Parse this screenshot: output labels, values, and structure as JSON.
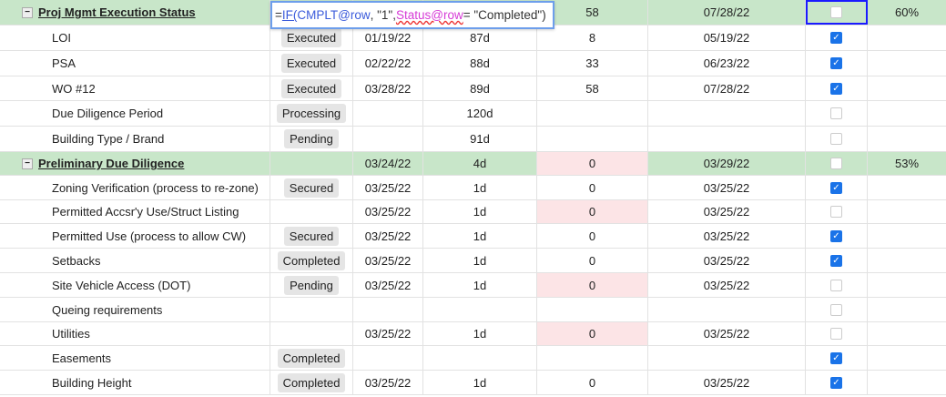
{
  "formula": {
    "eq": "=",
    "fn": "IF(",
    "ref1": "CMPLT@row",
    "mid": ", \"1\", ",
    "ref2": "Status@row",
    "tail": " = \"Completed\")"
  },
  "rows": [
    {
      "group": true,
      "name": "Proj Mgmt Execution Status",
      "status": "",
      "start": "",
      "dur": "",
      "num": "58",
      "end": "07/28/22",
      "checked": false,
      "pct": "60%",
      "pink": false,
      "selected": true
    },
    {
      "name": "LOI",
      "status": "Executed",
      "start": "01/19/22",
      "dur": "87d",
      "num": "8",
      "end": "05/19/22",
      "checked": true,
      "pct": ""
    },
    {
      "name": "PSA",
      "status": "Executed",
      "start": "02/22/22",
      "dur": "88d",
      "num": "33",
      "end": "06/23/22",
      "checked": true,
      "pct": ""
    },
    {
      "name": "WO #12",
      "status": "Executed",
      "start": "03/28/22",
      "dur": "89d",
      "num": "58",
      "end": "07/28/22",
      "checked": true,
      "pct": ""
    },
    {
      "name": "Due Diligence Period",
      "status": "Processing",
      "start": "",
      "dur": "120d",
      "num": "",
      "end": "",
      "checked": false,
      "pct": ""
    },
    {
      "name": "Building Type / Brand",
      "status": "Pending",
      "start": "",
      "dur": "91d",
      "num": "",
      "end": "",
      "checked": false,
      "pct": ""
    },
    {
      "group": true,
      "name": "Preliminary Due Diligence",
      "status": "",
      "start": "03/24/22",
      "dur": "4d",
      "num": "0",
      "end": "03/29/22",
      "checked": false,
      "pct": "53%",
      "pink": true
    },
    {
      "name": "Zoning Verification (process to re-zone)",
      "status": "Secured",
      "start": "03/25/22",
      "dur": "1d",
      "num": "0",
      "end": "03/25/22",
      "checked": true,
      "pct": ""
    },
    {
      "name": "Permitted Accsr'y Use/Struct Listing",
      "status": "",
      "start": "03/25/22",
      "dur": "1d",
      "num": "0",
      "end": "03/25/22",
      "checked": false,
      "pct": "",
      "pink": true
    },
    {
      "name": "Permitted Use (process to allow CW)",
      "status": "Secured",
      "start": "03/25/22",
      "dur": "1d",
      "num": "0",
      "end": "03/25/22",
      "checked": true,
      "pct": ""
    },
    {
      "name": "Setbacks",
      "status": "Completed",
      "start": "03/25/22",
      "dur": "1d",
      "num": "0",
      "end": "03/25/22",
      "checked": true,
      "pct": ""
    },
    {
      "name": "Site Vehicle Access (DOT)",
      "status": "Pending",
      "start": "03/25/22",
      "dur": "1d",
      "num": "0",
      "end": "03/25/22",
      "checked": false,
      "pct": "",
      "pink": true
    },
    {
      "name": "Queing requirements",
      "status": "",
      "start": "",
      "dur": "",
      "num": "",
      "end": "",
      "checked": false,
      "pct": ""
    },
    {
      "name": "Utilities",
      "status": "",
      "start": "03/25/22",
      "dur": "1d",
      "num": "0",
      "end": "03/25/22",
      "checked": false,
      "pct": "",
      "pink": true
    },
    {
      "name": "Easements",
      "status": "Completed",
      "start": "",
      "dur": "",
      "num": "",
      "end": "",
      "checked": true,
      "pct": ""
    },
    {
      "name": "Building Height",
      "status": "Completed",
      "start": "03/25/22",
      "dur": "1d",
      "num": "0",
      "end": "03/25/22",
      "checked": true,
      "pct": ""
    }
  ]
}
